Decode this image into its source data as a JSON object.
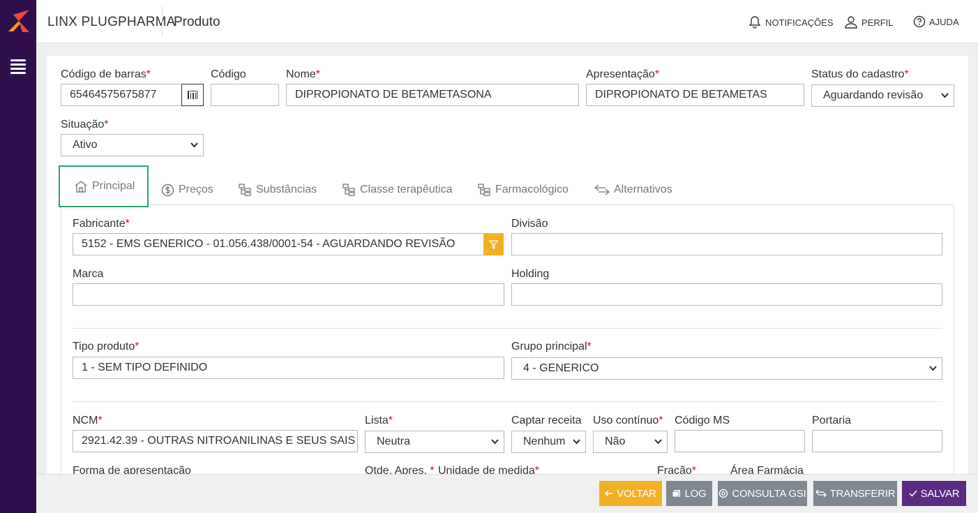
{
  "app": {
    "brand": "LINX PLUGPHARMA",
    "page_title": "Produto"
  },
  "header_actions": [
    {
      "label": "NOTIFICAÇÕES",
      "icon": "bell-icon"
    },
    {
      "label": "PERFIL",
      "icon": "user-icon"
    },
    {
      "label": "AJUDA",
      "icon": "help-icon"
    }
  ],
  "form": {
    "codigo_barras": {
      "label": "Código de barras",
      "value": "65464575675877"
    },
    "codigo": {
      "label": "Código",
      "value": ""
    },
    "nome": {
      "label": "Nome",
      "value": "DIPROPIONATO DE BETAMETASONA"
    },
    "apresentacao": {
      "label": "Apresentação",
      "value": "DIPROPIONATO DE BETAMETAS"
    },
    "status_cadastro": {
      "label": "Status do cadastro",
      "value": "Aguardando revisão"
    },
    "situacao": {
      "label": "Situação",
      "value": "Ativo"
    }
  },
  "tabs": [
    {
      "label": "Principal",
      "icon": "home-icon",
      "active": true
    },
    {
      "label": "Preços",
      "icon": "dollar-icon"
    },
    {
      "label": "Substâncias",
      "icon": "hierarchy-icon"
    },
    {
      "label": "Classe terapêutica",
      "icon": "hierarchy-icon"
    },
    {
      "label": "Farmacológico",
      "icon": "hierarchy-icon"
    },
    {
      "label": "Alternativos",
      "icon": "swap-icon"
    }
  ],
  "principal": {
    "fabricante": {
      "label": "Fabricante",
      "value": "5152 - EMS GENERICO - 01.056.438/0001-54 - AGUARDANDO REVISÃO"
    },
    "divisao": {
      "label": "Divisão",
      "value": ""
    },
    "marca": {
      "label": "Marca",
      "value": ""
    },
    "holding": {
      "label": "Holding",
      "value": ""
    },
    "tipo_produto": {
      "label": "Tipo produto",
      "value": "1 - SEM TIPO DEFINIDO"
    },
    "grupo_principal": {
      "label": "Grupo principal",
      "value": "4 - GENERICO"
    },
    "ncm": {
      "label": "NCM",
      "value": "2921.42.39 - OUTRAS NITROANILINAS E SEUS SAIS"
    },
    "lista": {
      "label": "Lista",
      "value": "Neutra"
    },
    "captar_receita": {
      "label": "Captar receita",
      "value": "Nenhum"
    },
    "uso_continuo": {
      "label": "Uso contínuo",
      "value": "Não"
    },
    "codigo_ms": {
      "label": "Código MS",
      "value": ""
    },
    "portaria": {
      "label": "Portaria",
      "value": ""
    },
    "forma_apresentacao": {
      "label": "Forma de apresentação"
    },
    "qtde_apres": {
      "label": "Qtde. Apres."
    },
    "unidade_medida": {
      "label": "Unidade de medida"
    },
    "fracao": {
      "label": "Fração"
    },
    "area_farmacia": {
      "label": "Área Farmácia"
    }
  },
  "footer_buttons": [
    {
      "label": "VOLTAR",
      "icon": "arrow-left-icon",
      "color": "#f2b026"
    },
    {
      "label": "LOG",
      "icon": "log-icon",
      "color": "#7f8791"
    },
    {
      "label": "CONSULTA GSI",
      "icon": "sync-icon",
      "color": "#7f8791"
    },
    {
      "label": "TRANSFERIR",
      "icon": "swap-icon",
      "color": "#7f8791"
    },
    {
      "label": "SALVAR",
      "icon": "check-icon",
      "color": "#5b2a82"
    }
  ],
  "colors": {
    "sidebar": "#2e0f4c",
    "active_tab_border": "#2aa56a",
    "required": "#c0181e"
  }
}
